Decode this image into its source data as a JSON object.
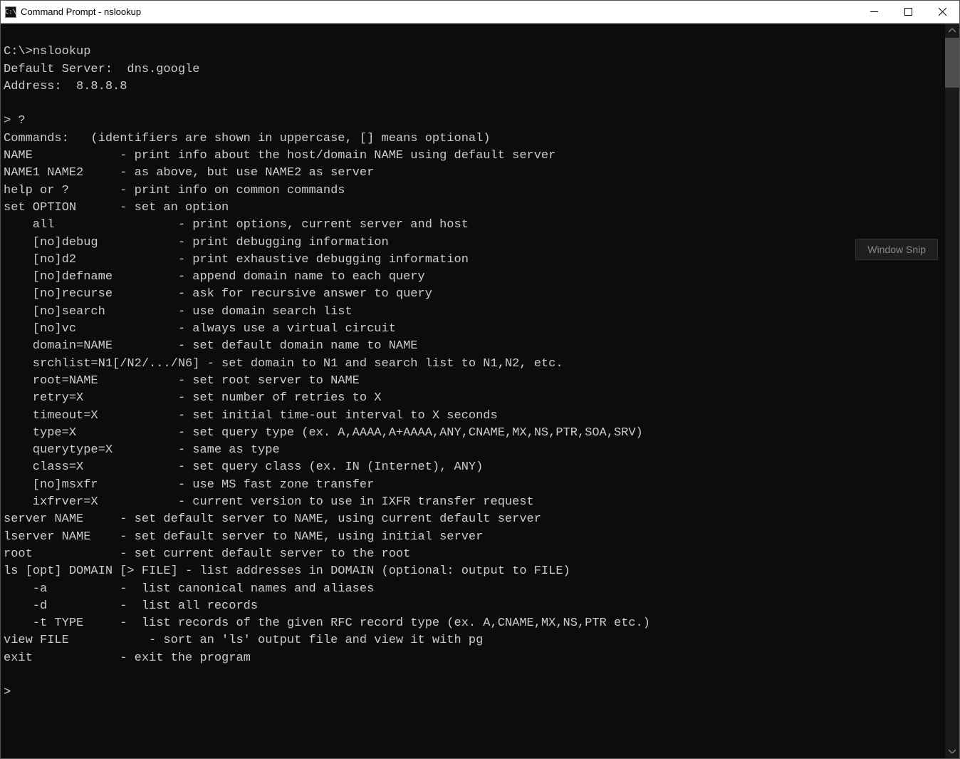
{
  "window": {
    "title": "Command Prompt - nslookup",
    "icon_label": "C:\\"
  },
  "ghost_button": "Window Snip",
  "terminal": {
    "lines": [
      "",
      "C:\\>nslookup",
      "Default Server:  dns.google",
      "Address:  8.8.8.8",
      "",
      "> ?",
      "Commands:   (identifiers are shown in uppercase, [] means optional)",
      "NAME            - print info about the host/domain NAME using default server",
      "NAME1 NAME2     - as above, but use NAME2 as server",
      "help or ?       - print info on common commands",
      "set OPTION      - set an option",
      "    all                 - print options, current server and host",
      "    [no]debug           - print debugging information",
      "    [no]d2              - print exhaustive debugging information",
      "    [no]defname         - append domain name to each query",
      "    [no]recurse         - ask for recursive answer to query",
      "    [no]search          - use domain search list",
      "    [no]vc              - always use a virtual circuit",
      "    domain=NAME         - set default domain name to NAME",
      "    srchlist=N1[/N2/.../N6] - set domain to N1 and search list to N1,N2, etc.",
      "    root=NAME           - set root server to NAME",
      "    retry=X             - set number of retries to X",
      "    timeout=X           - set initial time-out interval to X seconds",
      "    type=X              - set query type (ex. A,AAAA,A+AAAA,ANY,CNAME,MX,NS,PTR,SOA,SRV)",
      "    querytype=X         - same as type",
      "    class=X             - set query class (ex. IN (Internet), ANY)",
      "    [no]msxfr           - use MS fast zone transfer",
      "    ixfrver=X           - current version to use in IXFR transfer request",
      "server NAME     - set default server to NAME, using current default server",
      "lserver NAME    - set default server to NAME, using initial server",
      "root            - set current default server to the root",
      "ls [opt] DOMAIN [> FILE] - list addresses in DOMAIN (optional: output to FILE)",
      "    -a          -  list canonical names and aliases",
      "    -d          -  list all records",
      "    -t TYPE     -  list records of the given RFC record type (ex. A,CNAME,MX,NS,PTR etc.)",
      "view FILE           - sort an 'ls' output file and view it with pg",
      "exit            - exit the program",
      "",
      ">"
    ]
  }
}
